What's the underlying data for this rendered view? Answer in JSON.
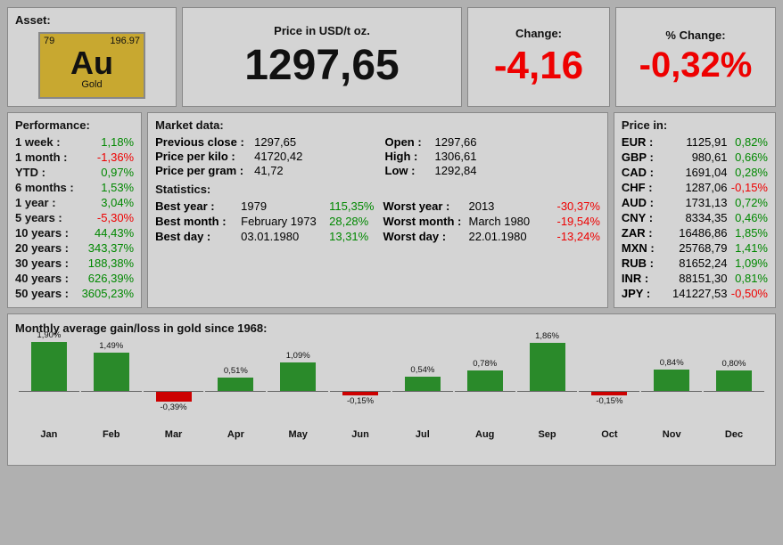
{
  "asset": {
    "title": "Asset:",
    "atomic_number": "79",
    "atomic_mass": "196.97",
    "symbol": "Au",
    "name": "Gold"
  },
  "price": {
    "title": "Price in USD/t oz.",
    "value": "1297,65"
  },
  "change": {
    "title": "Change:",
    "value": "-4,16"
  },
  "pct_change": {
    "title": "% Change:",
    "value": "-0,32%"
  },
  "performance": {
    "title": "Performance:",
    "rows": [
      {
        "label": "1 week :",
        "value": "1,18%",
        "positive": true
      },
      {
        "label": "1 month :",
        "value": "-1,36%",
        "positive": false
      },
      {
        "label": "YTD :",
        "value": "0,97%",
        "positive": true
      },
      {
        "label": "6 months :",
        "value": "1,53%",
        "positive": true
      },
      {
        "label": "1 year :",
        "value": "3,04%",
        "positive": true
      },
      {
        "label": "5 years :",
        "value": "-5,30%",
        "positive": false
      },
      {
        "label": "10 years :",
        "value": "44,43%",
        "positive": true
      },
      {
        "label": "20 years :",
        "value": "343,37%",
        "positive": true
      },
      {
        "label": "30 years :",
        "value": "188,38%",
        "positive": true
      },
      {
        "label": "40 years :",
        "value": "626,39%",
        "positive": true
      },
      {
        "label": "50 years :",
        "value": "3605,23%",
        "positive": true
      }
    ]
  },
  "market": {
    "title": "Market data:",
    "left": [
      {
        "key": "Previous close :",
        "value": "1297,65"
      },
      {
        "key": "Price per kilo :",
        "value": "41720,42"
      },
      {
        "key": "Price per gram :",
        "value": "41,72"
      }
    ],
    "right": [
      {
        "key": "Open :",
        "value": "1297,66"
      },
      {
        "key": "High :",
        "value": "1306,61"
      },
      {
        "key": "Low :",
        "value": "1292,84"
      }
    ]
  },
  "statistics": {
    "title": "Statistics:",
    "rows": [
      {
        "key": "Best year :",
        "date": "1979",
        "pct": "115,35%",
        "positive": true
      },
      {
        "key": "Best month :",
        "date": "February 1973",
        "pct": "28,28%",
        "positive": true
      },
      {
        "key": "Best day :",
        "date": "03.01.1980",
        "pct": "13,31%",
        "positive": true
      },
      {
        "key": "Worst year :",
        "date": "2013",
        "pct": "-30,37%",
        "positive": false
      },
      {
        "key": "Worst month :",
        "date": "March 1980",
        "pct": "-19,54%",
        "positive": false
      },
      {
        "key": "Worst day :",
        "date": "22.01.1980",
        "pct": "-13,24%",
        "positive": false
      }
    ]
  },
  "price_in": {
    "title": "Price in:",
    "rows": [
      {
        "currency": "EUR :",
        "value": "1125,91",
        "pct": "0,82%",
        "positive": true
      },
      {
        "currency": "GBP :",
        "value": "980,61",
        "pct": "0,66%",
        "positive": true
      },
      {
        "currency": "CAD :",
        "value": "1691,04",
        "pct": "0,28%",
        "positive": true
      },
      {
        "currency": "CHF :",
        "value": "1287,06",
        "pct": "-0,15%",
        "positive": false
      },
      {
        "currency": "AUD :",
        "value": "1731,13",
        "pct": "0,72%",
        "positive": true
      },
      {
        "currency": "CNY :",
        "value": "8334,35",
        "pct": "0,46%",
        "positive": true
      },
      {
        "currency": "ZAR :",
        "value": "16486,86",
        "pct": "1,85%",
        "positive": true
      },
      {
        "currency": "MXN :",
        "value": "25768,79",
        "pct": "1,41%",
        "positive": true
      },
      {
        "currency": "RUB :",
        "value": "81652,24",
        "pct": "1,09%",
        "positive": true
      },
      {
        "currency": "INR :",
        "value": "88151,30",
        "pct": "0,81%",
        "positive": true
      },
      {
        "currency": "JPY :",
        "value": "141227,53",
        "pct": "-0,50%",
        "positive": false
      }
    ]
  },
  "chart": {
    "title": "Monthly average gain/loss in gold since 1968:",
    "months": [
      {
        "label": "Jan",
        "pct": "1,90%",
        "value": 1.9
      },
      {
        "label": "Feb",
        "pct": "1,49%",
        "value": 1.49
      },
      {
        "label": "Mar",
        "pct": "-0,39%",
        "value": -0.39
      },
      {
        "label": "Apr",
        "pct": "0,51%",
        "value": 0.51
      },
      {
        "label": "May",
        "pct": "1,09%",
        "value": 1.09
      },
      {
        "label": "Jun",
        "pct": "-0,15%",
        "value": -0.15
      },
      {
        "label": "Jul",
        "pct": "0,54%",
        "value": 0.54
      },
      {
        "label": "Aug",
        "pct": "0,78%",
        "value": 0.78
      },
      {
        "label": "Sep",
        "pct": "1,86%",
        "value": 1.86
      },
      {
        "label": "Oct",
        "pct": "-0,15%",
        "value": -0.15
      },
      {
        "label": "Nov",
        "pct": "0,84%",
        "value": 0.84
      },
      {
        "label": "Dec",
        "pct": "0,80%",
        "value": 0.8
      }
    ]
  }
}
